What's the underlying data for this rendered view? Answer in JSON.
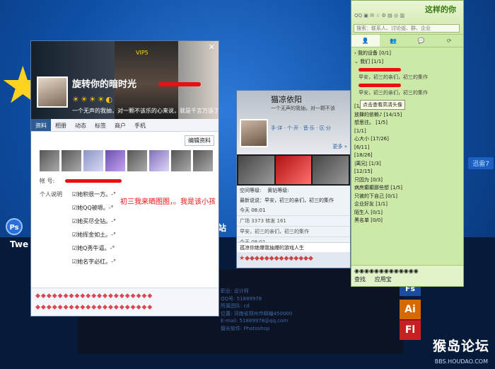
{
  "desktop": {
    "ps_label": "Ps",
    "ps_text": "Twe",
    "xun_button": "迅雷7",
    "site_text": "站",
    "watermark": "猴岛论坛",
    "watermark_url": "BBS.HOUDAO.COM",
    "icons": {
      "fs": "Fs",
      "ai": "Ai",
      "fl": "Fl"
    },
    "profile_lines": [
      "职业:   设计师",
      "QQ号:   51889978",
      "所属团队: cd",
      "位置:   河南省郑州市邮编450000",
      "E-mail: 51889978@qq.com",
      "擅长软件: Photoshop"
    ]
  },
  "card_a": {
    "banner_title": "旋转你的暗时光",
    "nickname": "旋转你的暗时光",
    "vip": "VIP5",
    "signature": "一个无声的我抽，对一颗不该乐的心来说，就是千言万语了。",
    "badges": "☀☀☀☀◐",
    "close": "✕",
    "tabs": [
      "资料",
      "相册",
      "动态",
      "标签",
      "商户",
      "手机"
    ],
    "edit_button": "编辑资料",
    "account_label": "帐  号:",
    "intro_label": "个人说明",
    "intro_items": [
      "☑她积很一方。-°",
      "☑她QQ被嗯。-°",
      "☑她买尽全钻。-°",
      "☑她挥金如土。-°",
      "☑她Q秀牛逼。-°",
      "☑她名字必红。-°"
    ],
    "red_note": "初三我来晒图图，。我是该小孩",
    "footer_icons_row1": "◆◆◆◆◆◆◆◆◆◆◆◆◆◆◆◆◆◆◆◆◆",
    "footer_icons_row2": "◆◆◆◆◆◆◆◆◆◆◆◆◆◆◆◆◆◆◆◆◆"
  },
  "card_b": {
    "nickname": "猫凉依阳",
    "signature": "一个无声的我抽，对一颗不该",
    "menu": "手·详 · 个·开 · 音·乐 · 区·分",
    "more": "更多 »",
    "space_level": "空间等级:",
    "qq_level": "黄钻等级:",
    "recent_1": "最新说说：早安，初三的亲们，初三的集作",
    "time_1": "今天 08:01",
    "friend_stats": "广场 3373  转发 161",
    "recent_2": "早安，初三的亲们，初三的集作",
    "time_2": "今天 08:01",
    "bar_text": "孤凉你绝爆我抽爆的游戏人生",
    "footer_icons": "★◆◆◆◆◆◆◆◆◆◆◆◆◆◆"
  },
  "panel": {
    "label": "这样的你",
    "icons_text": "QQ ▣ ✉ ☆ ⚙ ▤ ◎ ▥",
    "search_placeholder": "搜索：联系人、讨论组、群、企业",
    "tabs": [
      "👤",
      "👥",
      "💬",
      "⟳"
    ],
    "groups": [
      {
        "name": "我的设备",
        "count": "[0/1]"
      },
      {
        "name": "我们",
        "count": "[1/1]"
      }
    ],
    "contact_line": "早安，初三的亲们，初三的集作",
    "tooltip": "点击查看高清头像",
    "more_groups": [
      {
        "name": "[1/4]"
      },
      {
        "name": "放肆的依赖♪",
        "count": "[14/15]"
      },
      {
        "name": "想思往。",
        "count": "[1/5]"
      },
      {
        "name": "[1/1]"
      },
      {
        "name": "心大小",
        "count": "[17/26]"
      },
      {
        "name": "[6/11]"
      },
      {
        "name": "[18/26]"
      },
      {
        "name": "|离兄|",
        "count": "[1/3]"
      },
      {
        "name": "[12/15]"
      },
      {
        "name": "只因为",
        "count": "[0/3]"
      },
      {
        "name": "病房癫癫那些想",
        "count": "[1/5]"
      },
      {
        "name": "只被的下自己",
        "count": "[0/1]"
      },
      {
        "name": "企业好友",
        "count": "[1/1]"
      },
      {
        "name": "陌生人",
        "count": "[0/1]"
      },
      {
        "name": "黑名单",
        "count": "[0/0]"
      }
    ],
    "footer_find": "查找",
    "footer_app": "应用宝"
  }
}
